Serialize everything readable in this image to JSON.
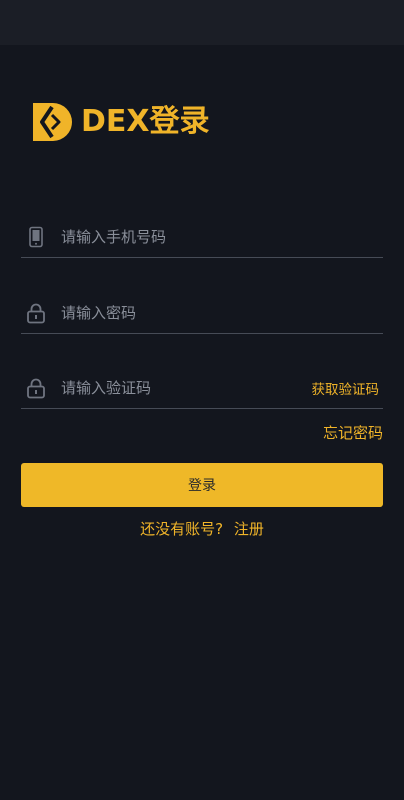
{
  "status_bar": {},
  "brand": {
    "logo_icon": "dex-logo-icon",
    "title": "DEX登录",
    "accent_color": "#f0b429"
  },
  "form": {
    "phone": {
      "icon": "phone-icon",
      "placeholder": "请输入手机号码",
      "value": ""
    },
    "password": {
      "icon": "lock-icon",
      "placeholder": "请输入密码",
      "value": ""
    },
    "code": {
      "icon": "lock-icon",
      "placeholder": "请输入验证码",
      "value": "",
      "get_code_label": "获取验证码"
    },
    "forgot_label": "忘记密码",
    "login_label": "登录"
  },
  "footer": {
    "prompt": "还没有账号?",
    "register_label": "注册"
  },
  "colors": {
    "background": "#13161e",
    "accent": "#f0b429",
    "button": "#efb828",
    "divider": "#464b56"
  }
}
